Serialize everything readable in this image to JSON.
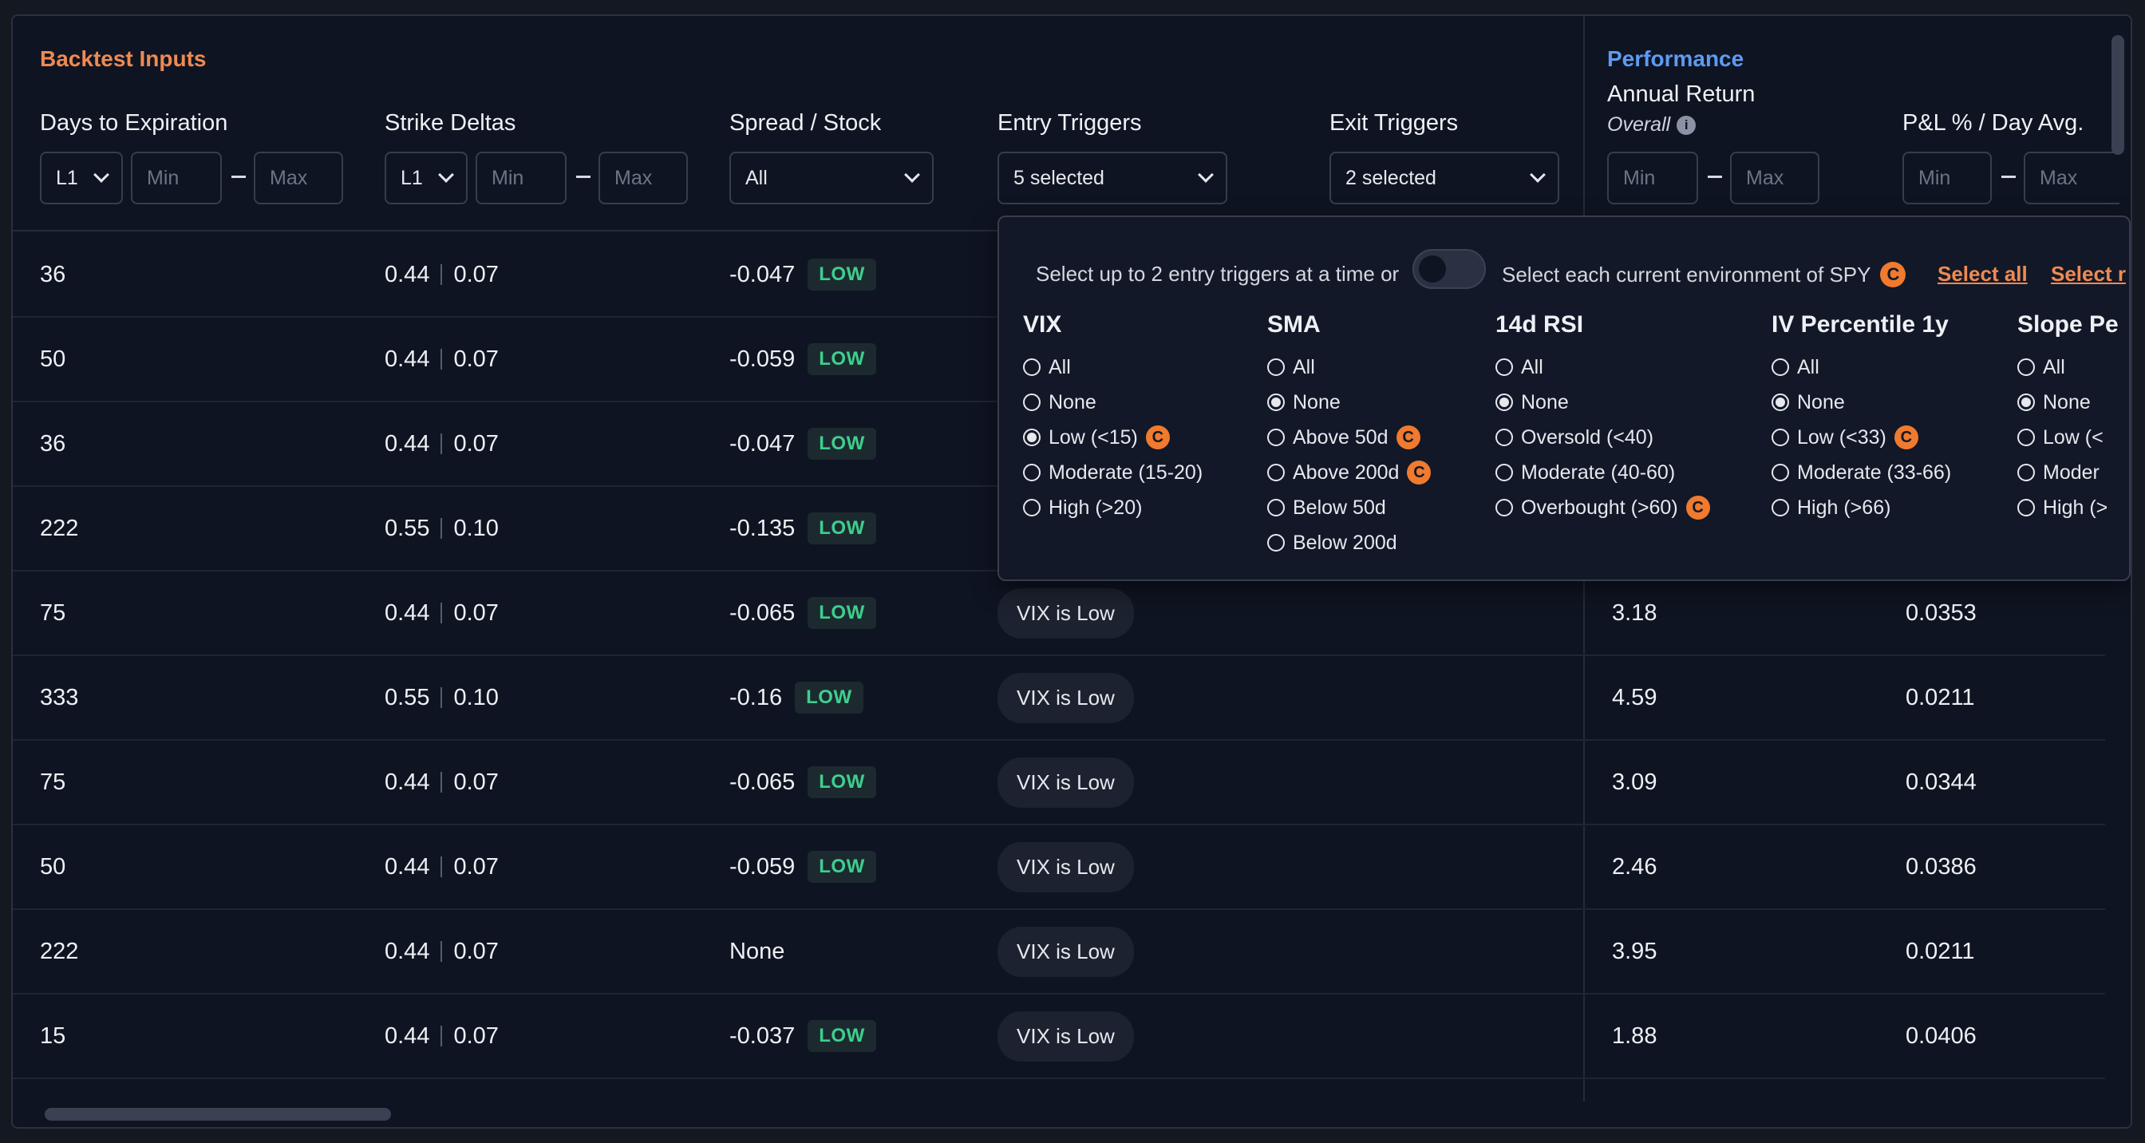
{
  "header": {
    "inputs_title": "Backtest Inputs",
    "performance_title": "Performance",
    "columns": {
      "dte": "Days to Expiration",
      "deltas": "Strike Deltas",
      "spread": "Spread / Stock",
      "entry": "Entry Triggers",
      "exit": "Exit Triggers",
      "annual": "Annual Return",
      "annual_sub": "Overall",
      "pl": "P&L % / Day Avg."
    },
    "filters": {
      "dte_leg": "L1",
      "deltas_leg": "L1",
      "min_placeholder": "Min",
      "max_placeholder": "Max",
      "spread_value": "All",
      "entry_value": "5 selected",
      "exit_value": "2 selected"
    }
  },
  "dropdown": {
    "intro": "Select up to 2 entry triggers at a time or",
    "env_label": "Select each current environment of SPY",
    "c_glyph": "C",
    "info_glyph": "i",
    "select_all": "Select all",
    "select_none": "Select r",
    "groups": [
      {
        "title": "VIX",
        "options": [
          {
            "label": "All",
            "checked": false,
            "c": false
          },
          {
            "label": "None",
            "checked": false,
            "c": false
          },
          {
            "label": "Low (<15)",
            "checked": true,
            "c": true
          },
          {
            "label": "Moderate (15-20)",
            "checked": false,
            "c": false
          },
          {
            "label": "High (>20)",
            "checked": false,
            "c": false
          }
        ]
      },
      {
        "title": "SMA",
        "options": [
          {
            "label": "All",
            "checked": false,
            "c": false
          },
          {
            "label": "None",
            "checked": true,
            "c": false
          },
          {
            "label": "Above 50d",
            "checked": false,
            "c": true
          },
          {
            "label": "Above 200d",
            "checked": false,
            "c": true
          },
          {
            "label": "Below 50d",
            "checked": false,
            "c": false
          },
          {
            "label": "Below 200d",
            "checked": false,
            "c": false
          }
        ]
      },
      {
        "title": "14d RSI",
        "options": [
          {
            "label": "All",
            "checked": false,
            "c": false
          },
          {
            "label": "None",
            "checked": true,
            "c": false
          },
          {
            "label": "Oversold (<40)",
            "checked": false,
            "c": false
          },
          {
            "label": "Moderate (40-60)",
            "checked": false,
            "c": false
          },
          {
            "label": "Overbought (>60)",
            "checked": false,
            "c": true
          }
        ]
      },
      {
        "title": "IV Percentile 1y",
        "options": [
          {
            "label": "All",
            "checked": false,
            "c": false
          },
          {
            "label": "None",
            "checked": true,
            "c": false
          },
          {
            "label": "Low (<33)",
            "checked": false,
            "c": true
          },
          {
            "label": "Moderate (33-66)",
            "checked": false,
            "c": false
          },
          {
            "label": "High (>66)",
            "checked": false,
            "c": false
          }
        ]
      },
      {
        "title": "Slope Pe",
        "options": [
          {
            "label": "All",
            "checked": false,
            "c": false
          },
          {
            "label": "None",
            "checked": true,
            "c": false
          },
          {
            "label": "Low (<",
            "checked": false,
            "c": false
          },
          {
            "label": "Moder",
            "checked": false,
            "c": false
          },
          {
            "label": "High (>",
            "checked": false,
            "c": false
          }
        ]
      }
    ]
  },
  "low_badge": "LOW",
  "rows": [
    {
      "dte": "36",
      "d1": "0.44",
      "d2": "0.07",
      "spread": "-0.047",
      "low": true,
      "entry": "",
      "annual": "",
      "pl": ""
    },
    {
      "dte": "50",
      "d1": "0.44",
      "d2": "0.07",
      "spread": "-0.059",
      "low": true,
      "entry": "",
      "annual": "",
      "pl": ""
    },
    {
      "dte": "36",
      "d1": "0.44",
      "d2": "0.07",
      "spread": "-0.047",
      "low": true,
      "entry": "",
      "annual": "",
      "pl": ""
    },
    {
      "dte": "222",
      "d1": "0.55",
      "d2": "0.10",
      "spread": "-0.135",
      "low": true,
      "entry": "",
      "annual": "",
      "pl": ""
    },
    {
      "dte": "75",
      "d1": "0.44",
      "d2": "0.07",
      "spread": "-0.065",
      "low": true,
      "entry": "VIX is Low",
      "annual": "3.18",
      "pl": "0.0353"
    },
    {
      "dte": "333",
      "d1": "0.55",
      "d2": "0.10",
      "spread": "-0.16",
      "low": true,
      "entry": "VIX is Low",
      "annual": "4.59",
      "pl": "0.0211"
    },
    {
      "dte": "75",
      "d1": "0.44",
      "d2": "0.07",
      "spread": "-0.065",
      "low": true,
      "entry": "VIX is Low",
      "annual": "3.09",
      "pl": "0.0344"
    },
    {
      "dte": "50",
      "d1": "0.44",
      "d2": "0.07",
      "spread": "-0.059",
      "low": true,
      "entry": "VIX is Low",
      "annual": "2.46",
      "pl": "0.0386"
    },
    {
      "dte": "222",
      "d1": "0.44",
      "d2": "0.07",
      "spread": "None",
      "low": false,
      "entry": "VIX is Low",
      "annual": "3.95",
      "pl": "0.0211"
    },
    {
      "dte": "15",
      "d1": "0.44",
      "d2": "0.07",
      "spread": "-0.037",
      "low": true,
      "entry": "VIX is Low",
      "annual": "1.88",
      "pl": "0.0406"
    }
  ]
}
